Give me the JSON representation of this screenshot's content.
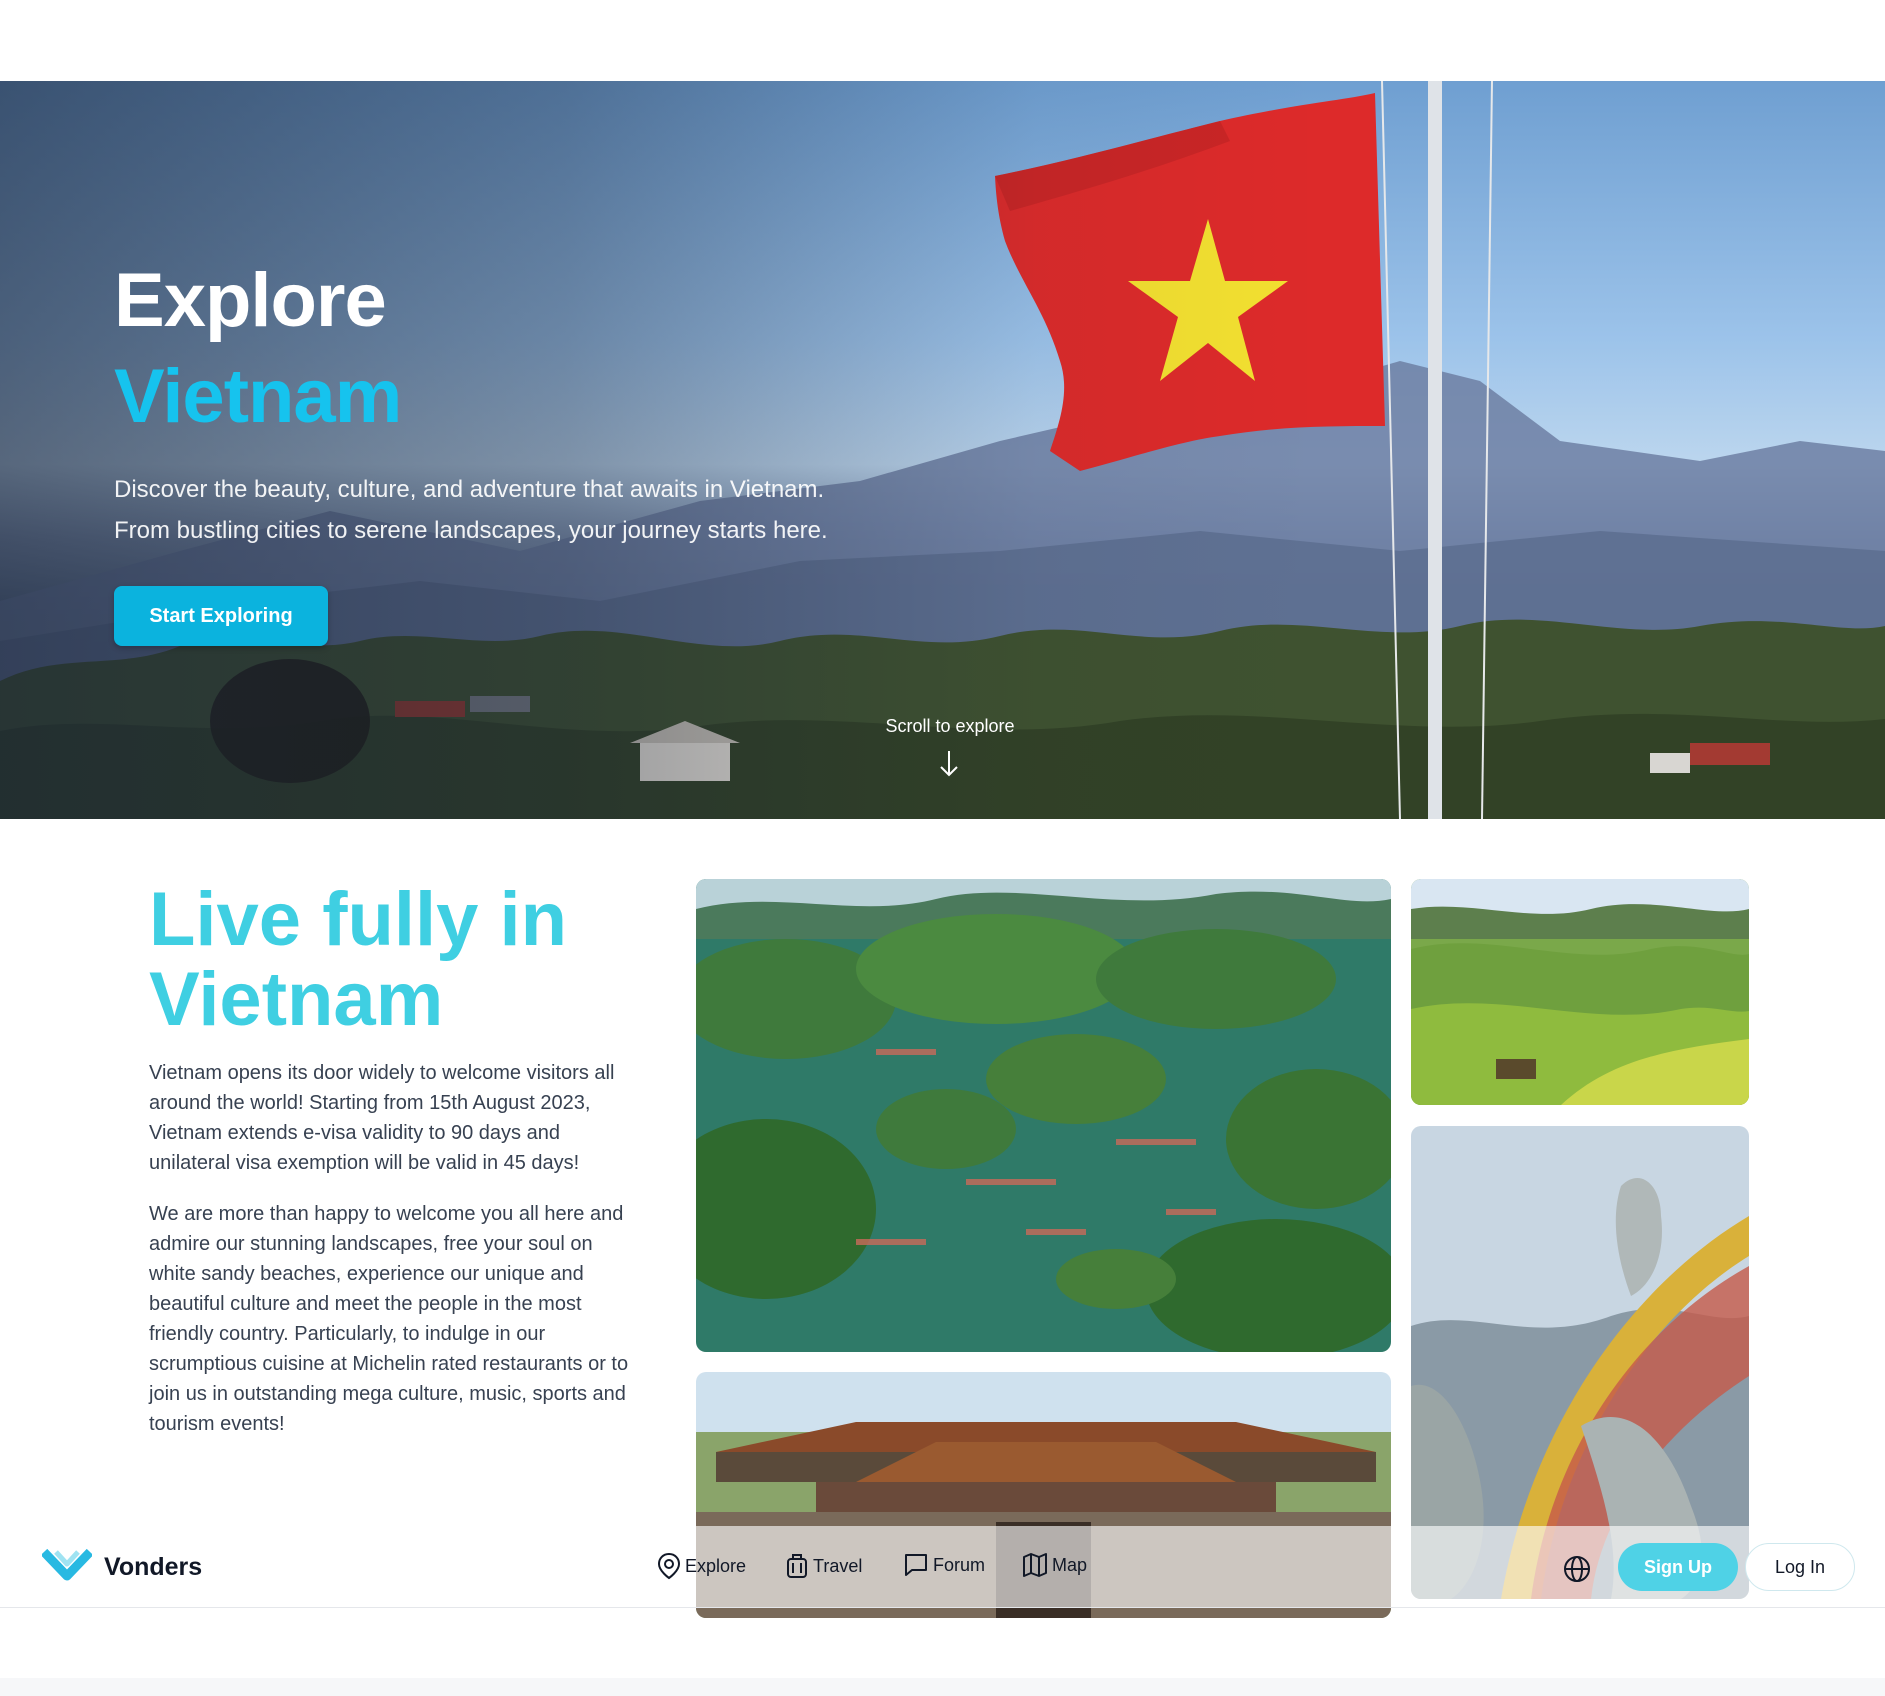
{
  "hero": {
    "title_line1": "Explore",
    "title_line2": "Vietnam",
    "subtitle_line1": "Discover the beauty, culture, and adventure that awaits in Vietnam.",
    "subtitle_line2": "From bustling cities to serene landscapes, your journey starts here.",
    "cta_label": "Start Exploring",
    "scroll_hint": "Scroll to explore"
  },
  "intro": {
    "title": "Live fully in Vietnam",
    "paragraph1": "Vietnam opens its door widely to welcome visitors all around the world! Starting from 15th August 2023, Vietnam extends e-visa validity to 90 days and unilateral visa exemption will be valid in 45 days!",
    "paragraph2": "We are more than happy to welcome you all here and admire our stunning landscapes, free your soul on white sandy beaches, experience our unique and beautiful culture and meet the people in the most friendly country. Particularly, to indulge in our scrumptious cuisine at Michelin rated restaurants or to join us in outstanding mega culture, music, sports and tourism events!"
  },
  "navbar": {
    "brand": "Vonders",
    "items": [
      {
        "label": "Explore",
        "icon": "map-pin-icon"
      },
      {
        "label": "Travel",
        "icon": "luggage-icon"
      },
      {
        "label": "Forum",
        "icon": "chat-bubble-icon"
      },
      {
        "label": "Map",
        "icon": "map-icon"
      }
    ],
    "language_icon": "globe-icon",
    "signup_label": "Sign Up",
    "login_label": "Log In"
  },
  "colors": {
    "accent": "#16c3ee",
    "cta": "#0bb3de",
    "heading": "#3fcfe2",
    "signup": "#4fd2e6",
    "flag_red": "#dd2a2a",
    "flag_star": "#f3e030"
  }
}
